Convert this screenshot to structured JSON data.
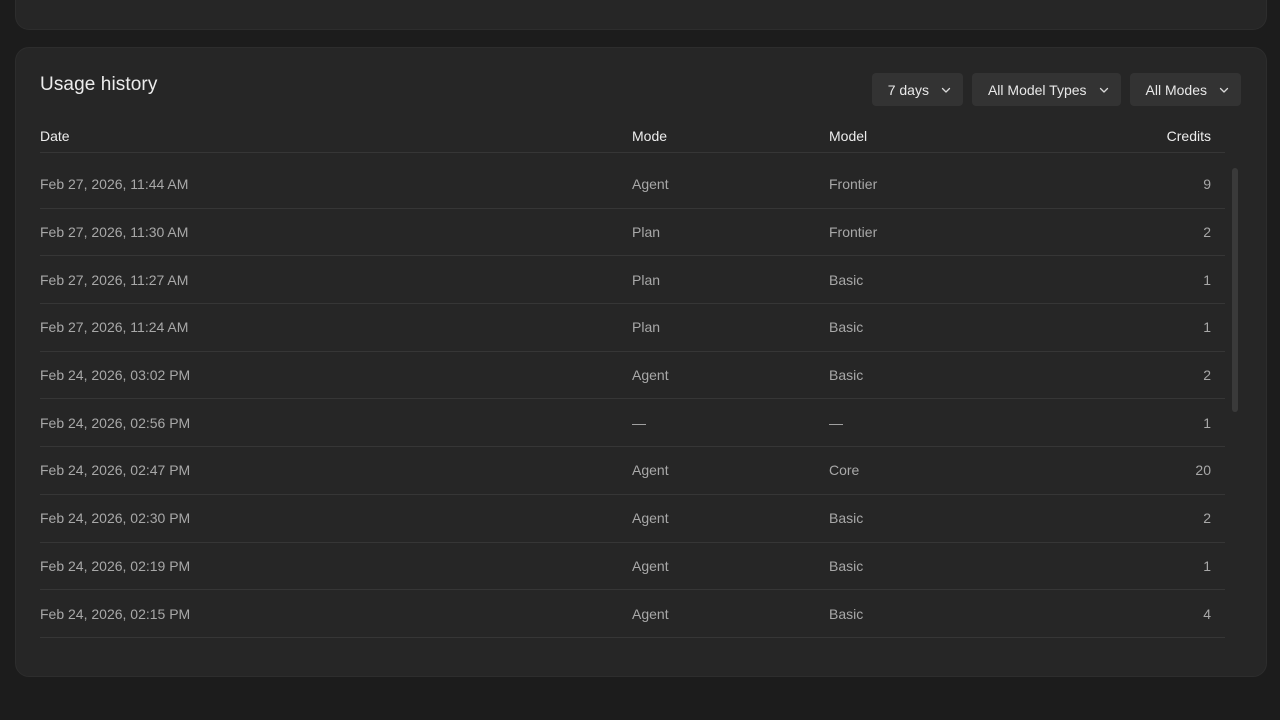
{
  "usage_history": {
    "title": "Usage history",
    "filters": {
      "range": "7 days",
      "model_types": "All Model Types",
      "modes": "All Modes"
    },
    "columns": {
      "date": "Date",
      "mode": "Mode",
      "model": "Model",
      "credits": "Credits"
    },
    "rows": [
      {
        "date": "Feb 27, 2026, 11:44 AM",
        "mode": "Agent",
        "model": "Frontier",
        "credits": "9"
      },
      {
        "date": "Feb 27, 2026, 11:30 AM",
        "mode": "Plan",
        "model": "Frontier",
        "credits": "2"
      },
      {
        "date": "Feb 27, 2026, 11:27 AM",
        "mode": "Plan",
        "model": "Basic",
        "credits": "1"
      },
      {
        "date": "Feb 27, 2026, 11:24 AM",
        "mode": "Plan",
        "model": "Basic",
        "credits": "1"
      },
      {
        "date": "Feb 24, 2026, 03:02 PM",
        "mode": "Agent",
        "model": "Basic",
        "credits": "2"
      },
      {
        "date": "Feb 24, 2026, 02:56 PM",
        "mode": "—",
        "model": "—",
        "credits": "1"
      },
      {
        "date": "Feb 24, 2026, 02:47 PM",
        "mode": "Agent",
        "model": "Core",
        "credits": "20"
      },
      {
        "date": "Feb 24, 2026, 02:30 PM",
        "mode": "Agent",
        "model": "Basic",
        "credits": "2"
      },
      {
        "date": "Feb 24, 2026, 02:19 PM",
        "mode": "Agent",
        "model": "Basic",
        "credits": "1"
      },
      {
        "date": "Feb 24, 2026, 02:15 PM",
        "mode": "Agent",
        "model": "Basic",
        "credits": "4"
      }
    ]
  },
  "icons": {
    "dropdown": "chevron-down-icon"
  },
  "colors": {
    "background": "#1c1c1c",
    "card": "#262626",
    "filter_button": "#333333",
    "row_text": "#a8a8a8",
    "header_text": "#ededed",
    "divider": "#363636"
  }
}
